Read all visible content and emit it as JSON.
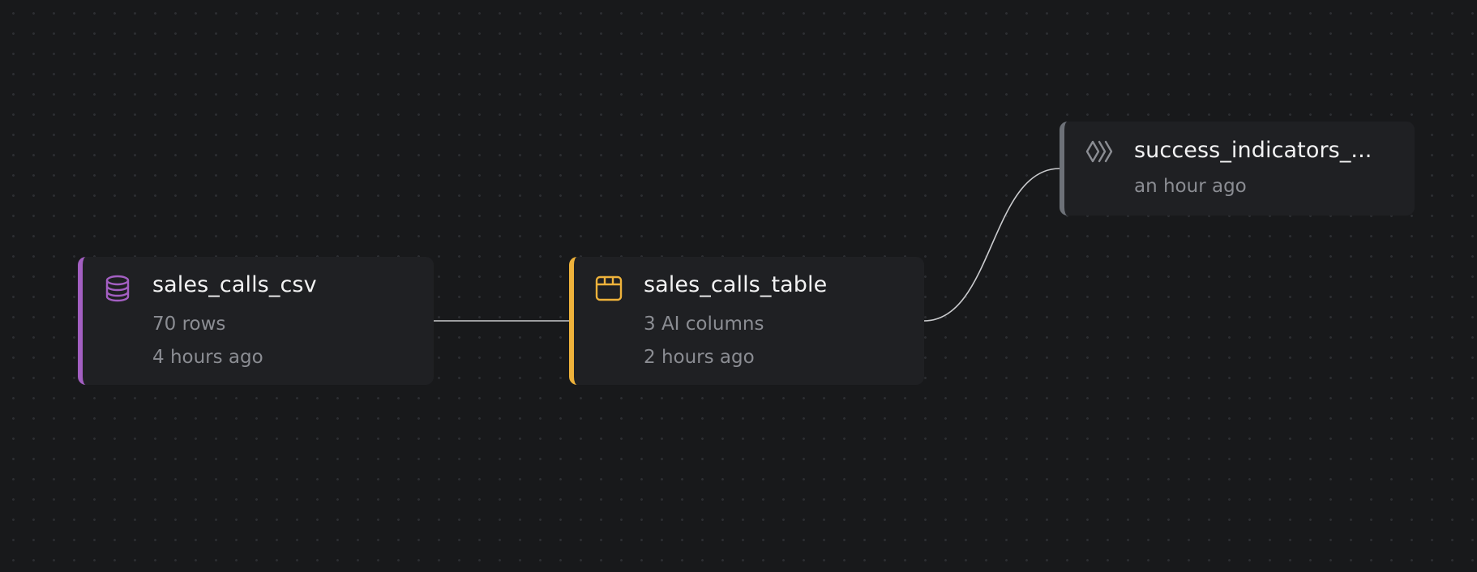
{
  "nodes": {
    "source": {
      "title": "sales_calls_csv",
      "rows": "70 rows",
      "time": "4 hours ago",
      "icon": "database-icon",
      "accent": "#a35fc2"
    },
    "table": {
      "title": "sales_calls_table",
      "columns": "3 AI columns",
      "time": "2 hours ago",
      "icon": "table-icon",
      "accent": "#eeb23b"
    },
    "model": {
      "title": "success_indicators_...",
      "time": "an hour ago",
      "icon": "chevrons-icon",
      "accent": "#6d7178"
    }
  },
  "edges": [
    {
      "from": "source",
      "to": "table"
    },
    {
      "from": "table",
      "to": "model"
    }
  ]
}
